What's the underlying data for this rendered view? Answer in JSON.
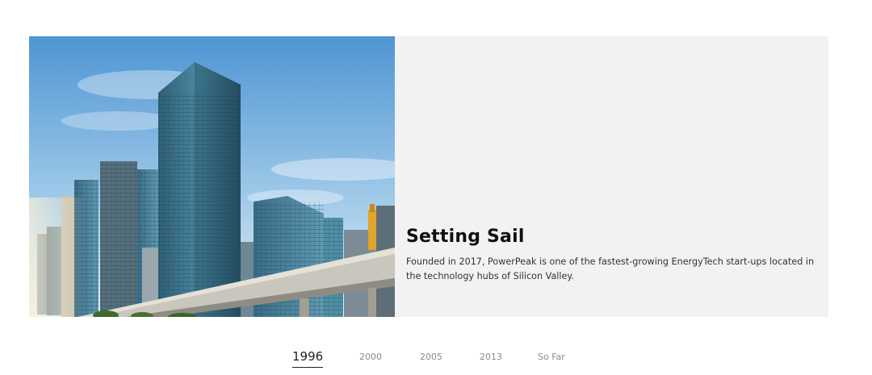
{
  "story": {
    "title": "Setting Sail",
    "body": "Founded in 2017, PowerPeak is one of the fastest-growing EnergyTech start-ups located in the technology hubs of Silicon Valley.",
    "image_subject": "city skyline with glass skyscrapers and elevated highway",
    "panel_color": "#f2f2f2"
  },
  "timeline": {
    "active_index": 0,
    "tabs": [
      {
        "label": "1996"
      },
      {
        "label": "2000"
      },
      {
        "label": "2005"
      },
      {
        "label": "2013"
      },
      {
        "label": "So Far"
      }
    ]
  },
  "colors": {
    "sky_top": "#5b9fd8",
    "sky_bottom": "#d9ebf6",
    "text_dark": "#111111",
    "tab_inactive": "#8a8a8a"
  }
}
